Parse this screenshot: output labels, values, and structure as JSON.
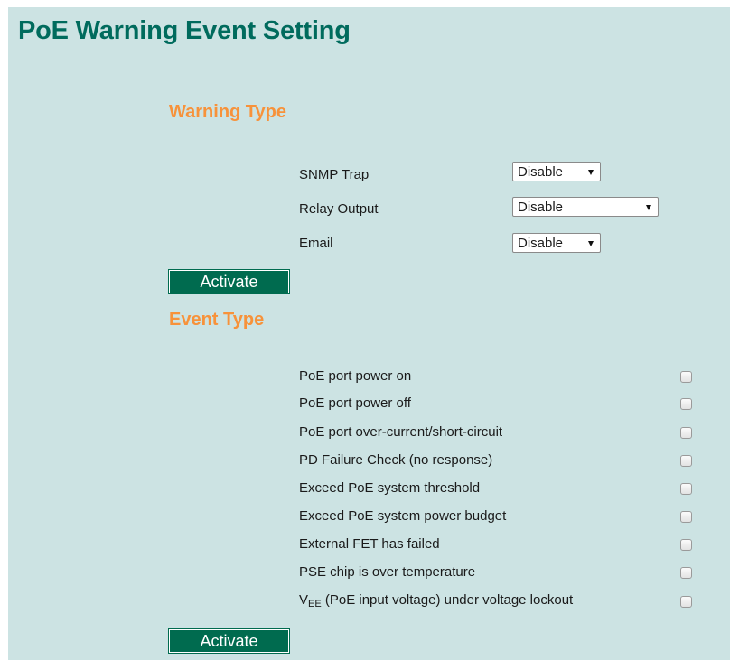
{
  "page": {
    "title": "PoE Warning Event Setting"
  },
  "warning_type": {
    "title": "Warning Type",
    "fields": [
      {
        "label": "SNMP Trap",
        "value": "Disable"
      },
      {
        "label": "Relay Output",
        "value": "Disable"
      },
      {
        "label": "Email",
        "value": "Disable"
      }
    ],
    "activate_label": "Activate"
  },
  "event_type": {
    "title": "Event Type",
    "events": [
      {
        "label": "PoE port power on",
        "checked": false
      },
      {
        "label": "PoE port power off",
        "checked": false
      },
      {
        "label": "PoE port over-current/short-circuit",
        "checked": false
      },
      {
        "label": "PD Failure Check (no response)",
        "checked": false
      },
      {
        "label": "Exceed PoE system threshold",
        "checked": false
      },
      {
        "label": "Exceed PoE system power budget",
        "checked": false
      },
      {
        "label": "External FET has failed",
        "checked": false
      },
      {
        "label": "PSE chip is over temperature",
        "checked": false
      },
      {
        "label_main": "V",
        "label_sub": "EE",
        "label_rest": " (PoE input voltage) under voltage lockout",
        "checked": false
      }
    ],
    "activate_label": "Activate"
  },
  "colors": {
    "background": "#cce3e3",
    "title": "#006b5d",
    "section_title": "#f7923a",
    "button": "#006b4f"
  }
}
